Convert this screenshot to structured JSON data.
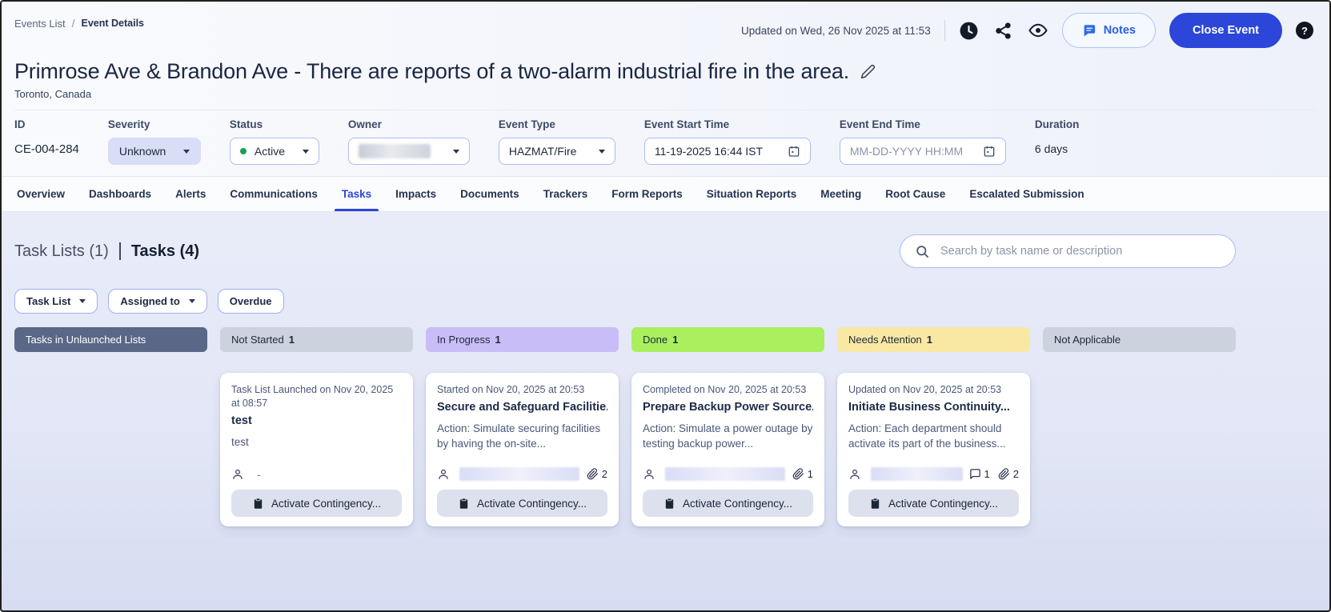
{
  "breadcrumb": {
    "parent": "Events List",
    "separator": "/",
    "current": "Event Details"
  },
  "topbar": {
    "updated_text": "Updated on Wed, 26 Nov 2025 at 11:53",
    "notes_button": "Notes",
    "close_event_button": "Close Event",
    "help_glyph": "?"
  },
  "event": {
    "title": "Primrose Ave & Brandon Ave - There are reports of a two-alarm industrial fire in the area.",
    "location": "Toronto, Canada",
    "id_label": "ID",
    "id_value": "CE-004-284",
    "severity_label": "Severity",
    "severity_value": "Unknown",
    "status_label": "Status",
    "status_value": "Active",
    "owner_label": "Owner",
    "event_type_label": "Event Type",
    "event_type_value": "HAZMAT/Fire",
    "start_label": "Event Start Time",
    "start_value": "11-19-2025 16:44 IST",
    "end_label": "Event End Time",
    "end_placeholder": "MM-DD-YYYY HH:MM",
    "duration_label": "Duration",
    "duration_value": "6 days"
  },
  "tabs": [
    {
      "label": "Overview",
      "active": false
    },
    {
      "label": "Dashboards",
      "active": false
    },
    {
      "label": "Alerts",
      "active": false
    },
    {
      "label": "Communications",
      "active": false
    },
    {
      "label": "Tasks",
      "active": true
    },
    {
      "label": "Impacts",
      "active": false
    },
    {
      "label": "Documents",
      "active": false
    },
    {
      "label": "Trackers",
      "active": false
    },
    {
      "label": "Form Reports",
      "active": false
    },
    {
      "label": "Situation Reports",
      "active": false
    },
    {
      "label": "Meeting",
      "active": false
    },
    {
      "label": "Root Cause",
      "active": false
    },
    {
      "label": "Escalated Submission",
      "active": false
    }
  ],
  "tasks": {
    "lists_summary": "Task Lists (1)",
    "tasks_summary": "Tasks (4)",
    "search_placeholder": "Search by task name or description",
    "filters": [
      {
        "label": "Task List",
        "caret": true
      },
      {
        "label": "Assigned to",
        "caret": true
      },
      {
        "label": "Overdue",
        "caret": false
      }
    ],
    "columns": [
      {
        "label": "Tasks in Unlaunched Lists",
        "count": "",
        "bg": "#5a6787",
        "fg": "#ffffff"
      },
      {
        "label": "Not Started",
        "count": "1",
        "bg": "#ccd2de",
        "fg": "#1d2939"
      },
      {
        "label": "In Progress",
        "count": "1",
        "bg": "#c9bdf7",
        "fg": "#1d2939"
      },
      {
        "label": "Done",
        "count": "1",
        "bg": "#a9ef5e",
        "fg": "#1d2939"
      },
      {
        "label": "Needs Attention",
        "count": "1",
        "bg": "#f9e8a4",
        "fg": "#1d2939"
      },
      {
        "label": "Not Applicable",
        "count": "",
        "bg": "#ccd2de",
        "fg": "#1d2939"
      }
    ],
    "cards": [
      {
        "column": 1,
        "date": "Task List Launched on Nov 20, 2025 at 08:57",
        "title": "test",
        "description": "test",
        "assignee_text": "-",
        "assignee_redacted": false,
        "comments": "",
        "attachments": "",
        "button": "Activate Contingency..."
      },
      {
        "column": 2,
        "date": "Started on Nov 20, 2025 at 20:53",
        "title": "Secure and Safeguard Facilitie...",
        "description": "Action: Simulate securing facilities by having the on-site...",
        "assignee_text": "",
        "assignee_redacted": true,
        "comments": "",
        "attachments": "2",
        "button": "Activate Contingency..."
      },
      {
        "column": 3,
        "date": "Completed on Nov 20, 2025 at 20:53",
        "title": "Prepare Backup Power Source...",
        "description": "Action: Simulate a power outage by testing backup power...",
        "assignee_text": "",
        "assignee_redacted": true,
        "comments": "",
        "attachments": "1",
        "button": "Activate Contingency..."
      },
      {
        "column": 4,
        "date": "Updated on Nov 20, 2025 at 20:53",
        "title": "Initiate Business Continuity...",
        "description": "Action: Each department should activate its part of the business...",
        "assignee_text": "",
        "assignee_redacted": true,
        "comments": "1",
        "attachments": "2",
        "button": "Activate Contingency..."
      }
    ]
  },
  "colors": {
    "accent_blue": "#2b46d9",
    "notes_blue": "#2b5fe0",
    "status_green": "#17a24f",
    "severity_bg": "#d7def5",
    "column_unlaunched": "#5a6787",
    "column_neutral": "#ccd2de",
    "column_in_progress": "#c9bdf7",
    "column_done": "#a9ef5e",
    "column_needs_attention": "#f9e8a4"
  }
}
